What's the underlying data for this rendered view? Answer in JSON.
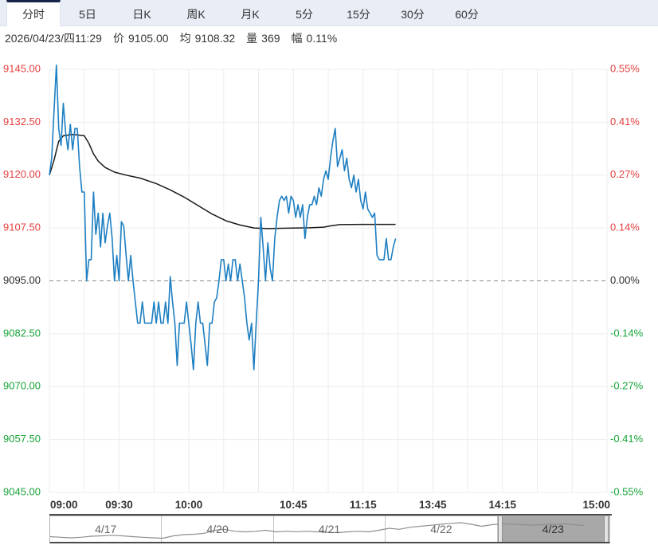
{
  "tabs": {
    "items": [
      {
        "label": "分时",
        "selected": true
      },
      {
        "label": "5日",
        "selected": false
      },
      {
        "label": "日K",
        "selected": false
      },
      {
        "label": "周K",
        "selected": false
      },
      {
        "label": "月K",
        "selected": false
      },
      {
        "label": "5分",
        "selected": false
      },
      {
        "label": "15分",
        "selected": false
      },
      {
        "label": "30分",
        "selected": false
      },
      {
        "label": "60分",
        "selected": false
      }
    ]
  },
  "status": {
    "datetime": "2026/04/23/四11:29",
    "price_label": "价",
    "price": "9105.00",
    "avg_label": "均",
    "avg": "9108.32",
    "volume_label": "量",
    "volume": "369",
    "range_label": "幅",
    "range": "0.11%"
  },
  "colors": {
    "up_red": "#e63f3f",
    "down_green": "#18a438",
    "neutral": "#2b2b2b",
    "price_line": "#1d7fc2",
    "avg_line": "#1a1a1a",
    "grid": "#ececec",
    "baseline_dash": "#8a8a8a",
    "tab_accent": "#17254a",
    "spark_line": "#8f8f8f",
    "axis_label": "#333333"
  },
  "chart_data": {
    "type": "line",
    "title": "期货分时走势 (intraday price vs average)",
    "baseline_price": 9095,
    "y_axis": {
      "price_ticks": [
        9145,
        9132.5,
        9120,
        9107.5,
        9095,
        9082.5,
        9070,
        9057.5,
        9045
      ],
      "price_tick_labels": [
        "9145.00",
        "9132.50",
        "9120.00",
        "9107.50",
        "9095.00",
        "9082.50",
        "9070.00",
        "9057.50",
        "9045.00"
      ],
      "pct_tick_labels": [
        "0.55%",
        "0.41%",
        "0.27%",
        "0.14%",
        "0.00%",
        "-0.14%",
        "-0.27%",
        "-0.41%",
        "-0.55%"
      ]
    },
    "x_axis": {
      "total_minutes": 240,
      "grid_step_minutes": 15,
      "tick_minutes": [
        0,
        30,
        60,
        105,
        135,
        165,
        195,
        240
      ],
      "tick_labels": [
        "09:00",
        "09:30",
        "10:00",
        "10:45",
        "11:15",
        "13:45",
        "14:15",
        "15:00"
      ]
    },
    "series": [
      {
        "name": "价",
        "role": "price",
        "values": [
          9120,
          9124,
          9135,
          9146,
          9131,
          9127,
          9137,
          9130,
          9126,
          9132,
          9126,
          9131,
          9131,
          9122,
          9116,
          9116,
          9095,
          9100,
          9100,
          9116,
          9106,
          9111,
          9103,
          9111,
          9104,
          9108,
          9111,
          9105,
          9095,
          9101,
          9095,
          9109,
          9108,
          9101,
          9095,
          9101,
          9095,
          9090,
          9085,
          9085,
          9090,
          9085,
          9085,
          9085,
          9085,
          9090,
          9085,
          9090,
          9085,
          9085,
          9090,
          9085,
          9096,
          9090,
          9085,
          9075,
          9085,
          9085,
          9085,
          9090,
          9085,
          9080,
          9074,
          9085,
          9090,
          9085,
          9085,
          9080,
          9075,
          9085,
          9085,
          9090,
          9091,
          9095,
          9100,
          9100,
          9095,
          9099,
          9095,
          9100,
          9100,
          9095,
          9099,
          9095,
          9091,
          9085,
          9081,
          9085,
          9074,
          9085,
          9095,
          9110,
          9103,
          9095,
          9104,
          9098,
          9095,
          9105,
          9110,
          9114,
          9115,
          9114,
          9115,
          9111,
          9115,
          9114,
          9110,
          9113,
          9110,
          9113,
          9105,
          9110,
          9113,
          9113,
          9115,
          9113,
          9117,
          9115,
          9119,
          9121,
          9119,
          9124,
          9128,
          9131,
          9122,
          9124,
          9126,
          9121,
          9124,
          9119,
          9117,
          9120,
          9116,
          9119,
          9114,
          9112,
          9116,
          9112,
          9111,
          9110,
          9111,
          9101,
          9100,
          9100,
          9100,
          9105,
          9100,
          9100,
          9103,
          9105
        ]
      },
      {
        "name": "均",
        "role": "average",
        "points": [
          [
            0,
            9120
          ],
          [
            2,
            9123.5
          ],
          [
            4,
            9128
          ],
          [
            6,
            9129.3
          ],
          [
            10,
            9129.6
          ],
          [
            15,
            9129.3
          ],
          [
            17,
            9127.5
          ],
          [
            19,
            9125
          ],
          [
            21,
            9123.3
          ],
          [
            24,
            9121.8
          ],
          [
            28,
            9120.7
          ],
          [
            33,
            9120
          ],
          [
            39,
            9119.3
          ],
          [
            46,
            9118
          ],
          [
            52,
            9116.5
          ],
          [
            58,
            9114.8
          ],
          [
            64,
            9112.8
          ],
          [
            70,
            9110.8
          ],
          [
            76,
            9109.2
          ],
          [
            82,
            9108.2
          ],
          [
            88,
            9107.5
          ],
          [
            94,
            9107.35
          ],
          [
            102,
            9107.45
          ],
          [
            112,
            9107.55
          ],
          [
            118,
            9107.7
          ],
          [
            121,
            9108
          ],
          [
            125,
            9108.3
          ],
          [
            135,
            9108.35
          ],
          [
            149,
            9108.35
          ]
        ]
      }
    ]
  },
  "navigator": {
    "sections": [
      {
        "label": "4/17",
        "selected": false
      },
      {
        "label": "4/20",
        "selected": false
      },
      {
        "label": "4/21",
        "selected": false
      },
      {
        "label": "4/22",
        "selected": false
      },
      {
        "label": "4/23",
        "selected": true
      }
    ],
    "spark": {
      "x_extent": 0.955,
      "values": [
        0.18,
        0.15,
        0.12,
        0.15,
        0.2,
        0.22,
        0.25,
        0.22,
        0.18,
        0.15,
        0.12,
        0.1,
        0.22,
        0.28,
        0.3,
        0.35,
        0.5,
        0.55,
        0.45,
        0.42,
        0.45,
        0.5,
        0.42,
        0.45,
        0.43,
        0.45,
        0.42,
        0.4,
        0.38,
        0.42,
        0.45,
        0.42,
        0.5,
        0.6,
        0.55,
        0.65,
        0.7,
        0.75,
        0.8,
        0.85,
        0.88,
        0.8,
        0.7,
        0.78,
        0.82,
        0.8,
        0.78,
        0.76,
        0.78,
        0.8,
        0.82,
        0.78,
        0.74
      ]
    }
  }
}
